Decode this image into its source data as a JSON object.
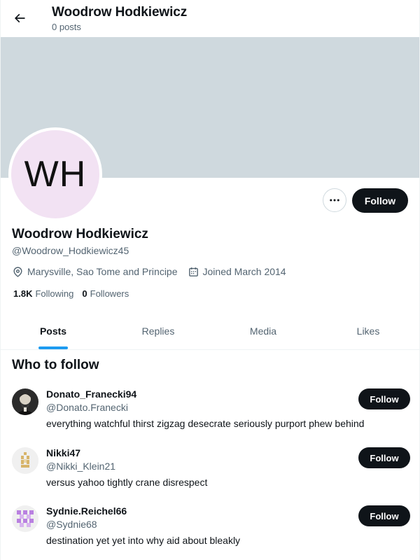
{
  "header": {
    "title": "Woodrow Hodkiewicz",
    "subtitle": "0 posts"
  },
  "profile": {
    "avatar_initials": "WH",
    "display_name": "Woodrow Hodkiewicz",
    "handle": "@Woodrow_Hodkiewicz45",
    "location": "Marysville, Sao Tome and Principe",
    "joined": "Joined March 2014",
    "following_count": "1.8K",
    "following_label": "Following",
    "followers_count": "0",
    "followers_label": "Followers",
    "more_label": "···",
    "follow_label": "Follow",
    "banner_color": "#cfd9de",
    "avatar_bg": "#f2e2f3"
  },
  "tabs": [
    {
      "label": "Posts",
      "active": true
    },
    {
      "label": "Replies",
      "active": false
    },
    {
      "label": "Media",
      "active": false
    },
    {
      "label": "Likes",
      "active": false
    }
  ],
  "who_to_follow": {
    "title": "Who to follow",
    "suggestions": [
      {
        "name": "Donato_Franecki94",
        "handle": "@Donato.Franecki",
        "bio": "everything watchful thirst zigzag desecrate seriously purport phew behind",
        "follow_label": "Follow",
        "avatar": "photo-portrait"
      },
      {
        "name": "Nikki47",
        "handle": "@Nikki_Klein21",
        "bio": "versus yahoo tightly crane disrespect",
        "follow_label": "Follow",
        "avatar": "identicon-gold"
      },
      {
        "name": "Sydnie.Reichel66",
        "handle": "@Sydnie68",
        "bio": "destination yet yet into why aid about bleakly",
        "follow_label": "Follow",
        "avatar": "identicon-purple"
      }
    ]
  },
  "colors": {
    "accent": "#1d9bf0",
    "primary_text": "#0f1419",
    "secondary_text": "#536471",
    "button_dark": "#0f1419"
  }
}
